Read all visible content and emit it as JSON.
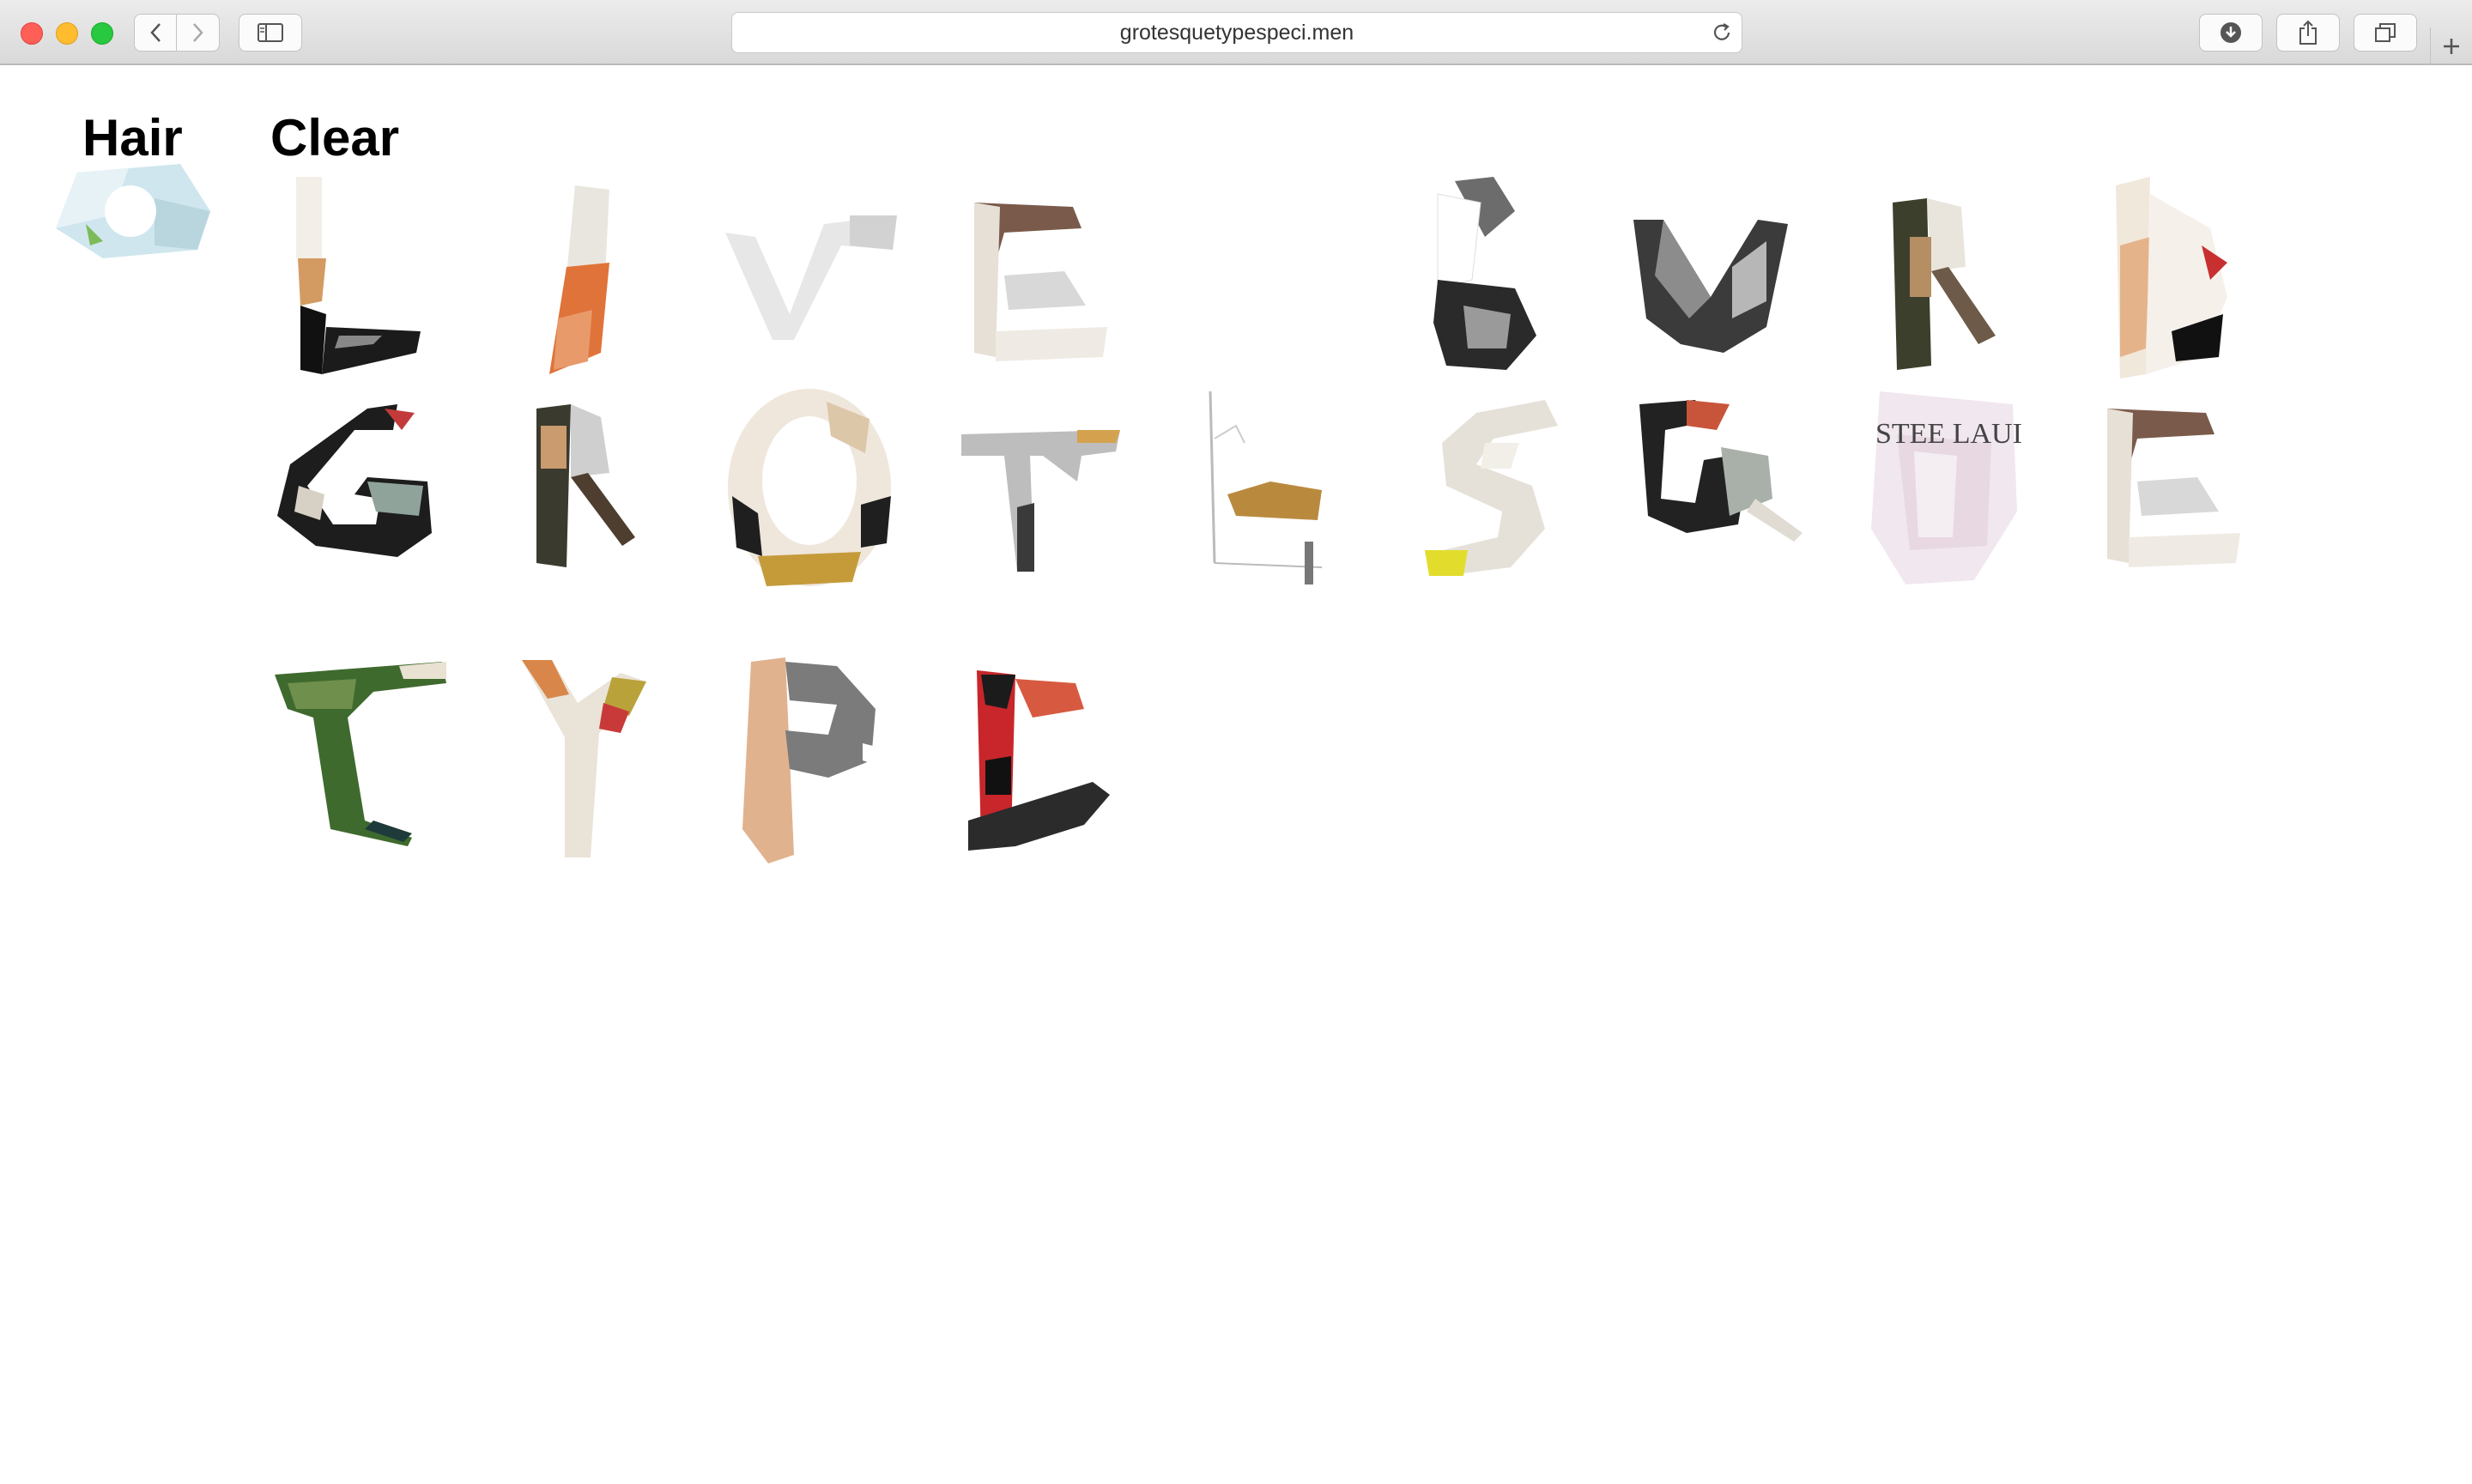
{
  "browser": {
    "url": "grotesquetypespeci.men",
    "buttons": [
      "back",
      "forward",
      "sidebar",
      "downloads",
      "share",
      "tabs",
      "new-tab"
    ]
  },
  "page": {
    "labels": {
      "hair": "Hair",
      "clear": "Clear"
    },
    "rows": [
      {
        "letters": [
          "O",
          "L",
          "I",
          "V",
          "E",
          "",
          "B",
          "U",
          "R",
          "D"
        ]
      },
      {
        "letters": [
          "G",
          "R",
          "O",
          "T",
          "E",
          "S",
          "Q",
          "U",
          "E"
        ]
      },
      {
        "letters": [
          "T",
          "Y",
          "P",
          "E"
        ]
      }
    ]
  },
  "colors": {
    "chrome_top": "#ececec",
    "close": "#fe5f57",
    "minimize": "#febc2e",
    "zoom": "#28c840"
  }
}
